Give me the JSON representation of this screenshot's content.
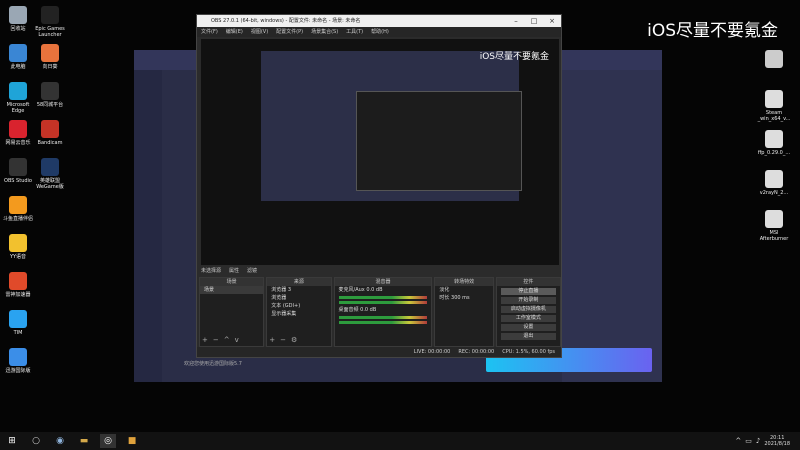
{
  "desktop": {
    "left_icons": [
      {
        "label": "回收站",
        "color": "#9aa7b4"
      },
      {
        "label": "Epic Games Launcher",
        "color": "#222"
      },
      {
        "label": "此电脑",
        "color": "#3a86d4"
      },
      {
        "label": "向日葵",
        "color": "#e8733c"
      },
      {
        "label": "Microsoft Edge",
        "color": "#1fa4d8"
      },
      {
        "label": "58同城平台",
        "color": "#333"
      },
      {
        "label": "网易云音乐",
        "color": "#d9232e"
      },
      {
        "label": "Bandicam",
        "color": "#c43326"
      },
      {
        "label": "OBS Studio",
        "color": "#333"
      },
      {
        "label": "英雄联盟 WeGame版",
        "color": "#1f3a66"
      },
      {
        "label": "斗鱼直播伴侣",
        "color": "#f39a1e"
      },
      {
        "label": "YY语音",
        "color": "#f2c12e"
      },
      {
        "label": "雷神加速器",
        "color": "#e04a2a"
      },
      {
        "label": "TIM",
        "color": "#2aa3f0"
      },
      {
        "label": "迅游国际版",
        "color": "#3b8ee8"
      }
    ],
    "right_icons": [
      {
        "label": "",
        "color": "#ccc"
      },
      {
        "label": "Steam _win_x64_v...",
        "color": "#ddd"
      },
      {
        "label": "ffp_0.29.0_...",
        "color": "#ddd"
      },
      {
        "label": "v2rayN_2...",
        "color": "#ddd"
      },
      {
        "label": "MSI Afterburner",
        "color": "#ddd"
      }
    ],
    "watermark": "iOS尽量不要氪金"
  },
  "bg_app": {
    "sidebar_labels": [
      "",
      "",
      "",
      "",
      "",
      "",
      "",
      ""
    ],
    "status_text": "欢迎您使用迅游国际版5.7"
  },
  "obs": {
    "title": "OBS 27.0.1 (64-bit, windows) - 配置文件: 未命名 - 场景: 未命名",
    "menu": [
      "文件(F)",
      "编辑(E)",
      "视图(V)",
      "配置文件(P)",
      "场景集合(S)",
      "工具(T)",
      "帮助(H)"
    ],
    "preview_watermark": "iOS尽量不要氪金",
    "scene_label": "未选择源",
    "properties_label": "属性",
    "filters_label": "滤镜",
    "docks": {
      "scenes": {
        "title": "场景",
        "items": [
          "场景"
        ]
      },
      "sources": {
        "title": "来源",
        "items": [
          "浏览器 3",
          "浏览器",
          "文本 (GDI+)",
          "显示器采集"
        ]
      },
      "mixer": {
        "title": "混音器",
        "tracks": [
          "麦克风/Aux",
          "桌面音频"
        ],
        "levels": [
          "0.0 dB",
          "0.0 dB"
        ]
      },
      "transitions": {
        "title": "转场特效",
        "type": "淡化",
        "duration_label": "时长",
        "duration": "300 ms"
      },
      "controls": {
        "title": "控件",
        "buttons": [
          "停止直播",
          "开始录制",
          "启动虚拟摄像机",
          "工作室模式",
          "设置",
          "退出"
        ]
      }
    },
    "status": [
      "LIVE: 00:00:00",
      "REC: 00:00:00",
      "CPU: 1.5%, 60.00 fps"
    ]
  },
  "taskbar": {
    "time": "20:11",
    "date": "2021/8/18"
  }
}
